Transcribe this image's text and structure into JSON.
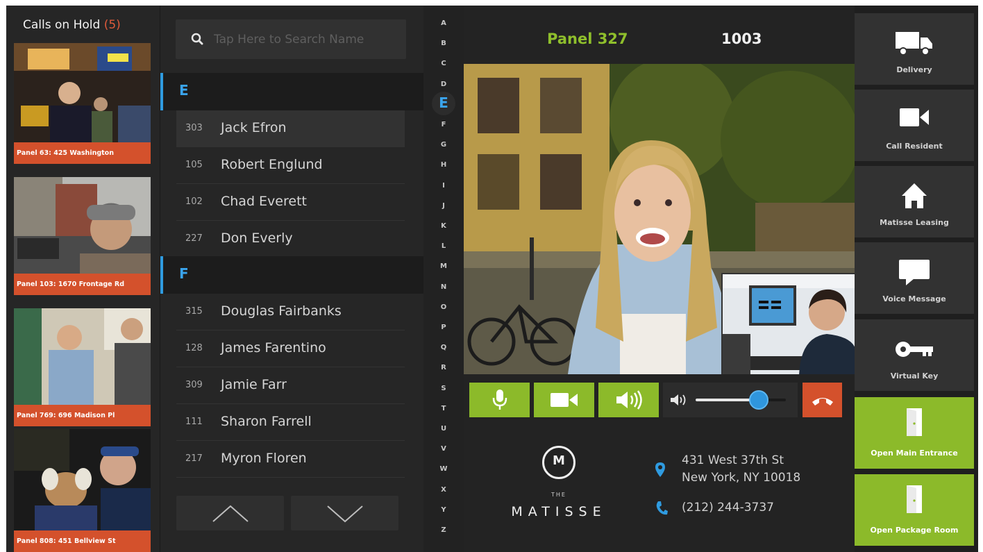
{
  "hold": {
    "title": "Calls on Hold",
    "count": "(5)",
    "calls": [
      {
        "label": "Panel 63: 425 Washington"
      },
      {
        "label": "Panel 103: 1670 Frontage Rd"
      },
      {
        "label": "Panel 769: 696 Madison Pl"
      },
      {
        "label": "Panel 808: 451 Bellview St"
      }
    ]
  },
  "search": {
    "placeholder": "Tap Here to Search Name"
  },
  "directory": {
    "groups": [
      {
        "letter": "E",
        "contacts": [
          {
            "unit": "303",
            "name": "Jack Efron"
          },
          {
            "unit": "105",
            "name": "Robert Englund"
          },
          {
            "unit": "102",
            "name": "Chad Everett"
          },
          {
            "unit": "227",
            "name": "Don Everly"
          }
        ]
      },
      {
        "letter": "F",
        "contacts": [
          {
            "unit": "315",
            "name": "Douglas Fairbanks"
          },
          {
            "unit": "128",
            "name": "James Farentino"
          },
          {
            "unit": "309",
            "name": "Jamie Farr"
          },
          {
            "unit": "111",
            "name": "Sharon Farrell"
          },
          {
            "unit": "217",
            "name": "Myron Floren"
          }
        ]
      }
    ]
  },
  "alphabet": [
    "A",
    "B",
    "C",
    "D",
    "E",
    "F",
    "G",
    "H",
    "I",
    "J",
    "K",
    "L",
    "M",
    "N",
    "O",
    "P",
    "Q",
    "R",
    "S",
    "T",
    "U",
    "V",
    "W",
    "X",
    "Y",
    "Z"
  ],
  "alphabet_active": "E",
  "call": {
    "panel": "Panel 327",
    "number": "1003",
    "volume": 0.7
  },
  "building": {
    "logo_letter": "M",
    "logo_the": "THE",
    "name": "MATISSE",
    "address_line1": "431 West 37th St",
    "address_line2": "New York, NY 10018",
    "phone": "(212) 244-3737"
  },
  "actions": [
    {
      "label": "Delivery",
      "icon": "truck-icon"
    },
    {
      "label": "Call Resident",
      "icon": "video-camera-icon"
    },
    {
      "label": "Matisse Leasing",
      "icon": "home-icon"
    },
    {
      "label": "Voice Message",
      "icon": "speech-bubble-icon"
    },
    {
      "label": "Virtual Key",
      "icon": "key-icon"
    },
    {
      "label": "Open Main Entrance",
      "icon": "door-icon"
    },
    {
      "label": "Open Package Room",
      "icon": "door-icon"
    }
  ],
  "colors": {
    "accent_green": "#8cba2a",
    "accent_blue": "#2f9be0",
    "alert_orange": "#d4512c",
    "background": "#232323"
  }
}
